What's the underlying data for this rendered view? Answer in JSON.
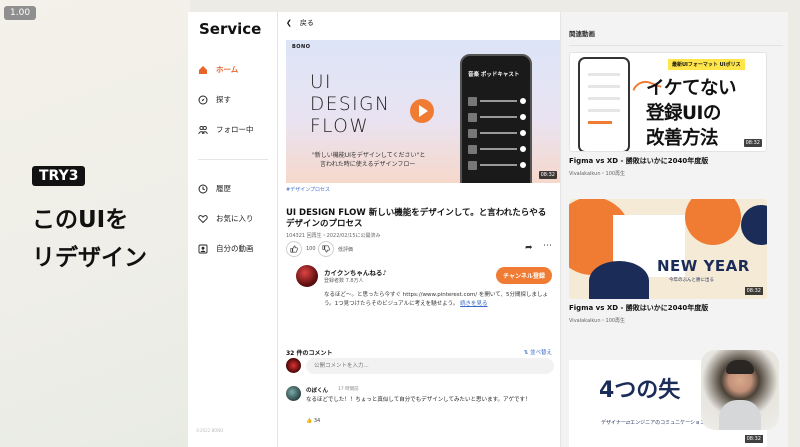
{
  "slide": {
    "zoom": "1.00",
    "badge": "TRY3",
    "heading_line1": "このUIを",
    "heading_line2": "リデザイン"
  },
  "sidebar": {
    "brand": "Service",
    "items": [
      {
        "label": "ホーム",
        "icon": "home-icon",
        "active": true
      },
      {
        "label": "探す",
        "icon": "compass-icon",
        "active": false
      },
      {
        "label": "フォロー中",
        "icon": "people-icon",
        "active": false
      },
      {
        "label": "履歴",
        "icon": "clock-icon",
        "active": false
      },
      {
        "label": "お気に入り",
        "icon": "heart-icon",
        "active": false
      },
      {
        "label": "自分の動画",
        "icon": "user-video-icon",
        "active": false
      }
    ],
    "copyright": "©2022 BONO"
  },
  "main": {
    "back_label": "戻る",
    "hero": {
      "brand": "BONO",
      "title_lines": [
        "UI",
        "DESIGN",
        "FLOW"
      ],
      "subtitle_line1": "\"新しい機能UIをデザインしてください\"と",
      "subtitle_line2": "言われた時に使えるデザインフロー",
      "phone_header": "音楽  ポッドキャスト",
      "duration": "08:32"
    },
    "tag": "#デザインプロセス",
    "title": "UI DESIGN FLOW 新しい機能をデザインして。と言われたらやるデザインのプロセス",
    "meta": "104321 回再生・2022/02/15に公開済み",
    "likes": "100",
    "dislike_label": "低評価",
    "channel": {
      "name": "カイクンちゃんねる♪",
      "subscribers": "登録者数 7.8万人",
      "subscribe_label": "チャンネル登録",
      "description": "なるほど〜。と思ったら今すぐ https://www.pinterest.com/ を開いて、5分間探しましょう。1つ見つけたらそのビジュアルに考えを馳せよう。",
      "more_label": "続きを見る"
    },
    "comments": {
      "count_label": "32 件のコメント",
      "sort_label": "並べ替え",
      "input_placeholder": "公開コメントを入力...",
      "items": [
        {
          "author": "のぼくん",
          "time": "17 時間前",
          "text": "なるほどでした！！ちょっと真似して自分でもデザインしてみたいと思います。アゲです！",
          "likes": "34"
        }
      ]
    }
  },
  "related": {
    "heading": "関連動画",
    "items": [
      {
        "title": "Figma vs XD - 勝敗はいかに2040年度版",
        "meta": "Vivalakaikun・100再生",
        "duration": "08:32",
        "thumb_tag": "最新UIフォーマット UIポリス",
        "thumb_text_lines": [
          "イケてない",
          "登録UIの",
          "改善方法"
        ]
      },
      {
        "title": "Figma vs XD - 勝敗はいかに2040年度版",
        "meta": "Vivalakaikun・100再生",
        "duration": "08:32",
        "thumb_text": "NEW YEAR",
        "thumb_sub": "今年のぶんと勝に出る"
      },
      {
        "thumb_text": "4つの失",
        "thumb_sub": "デザイナー⇄エンジニアのコミュニケーション",
        "duration": "08:32"
      }
    ]
  },
  "colors": {
    "accent": "#f07b32",
    "link": "#3b6bc9",
    "navy": "#1b2c58"
  }
}
